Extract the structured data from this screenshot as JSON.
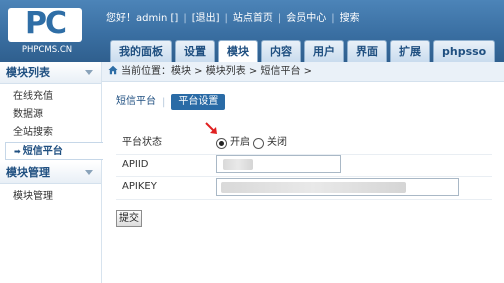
{
  "logo": {
    "text": "PC",
    "sub": "PHPCMS.CN"
  },
  "toplinks": {
    "greeting": "您好！admin []",
    "logout": "[退出]",
    "site_home": "站点首页",
    "member_center": "会员中心",
    "search": "搜索"
  },
  "nav": {
    "tabs": [
      "我的面板",
      "设置",
      "模块",
      "内容",
      "用户",
      "界面",
      "扩展",
      "phpsso"
    ],
    "active_index": 2
  },
  "sidebar": {
    "group1_title": "模块列表",
    "items": [
      "在线充值",
      "数据源",
      "全站搜索",
      "短信平台"
    ],
    "active_item": "短信平台",
    "group2_title": "模块管理",
    "group2_items": [
      "模块管理"
    ]
  },
  "breadcrumb": {
    "prefix": "当前位置：",
    "path": "模块 > 模块列表 > 短信平台 >"
  },
  "subtabs": {
    "first": "短信平台",
    "second": "平台设置"
  },
  "form": {
    "status_label": "平台状态",
    "status_on": "开启",
    "status_off": "关闭",
    "status_value": "开启",
    "apiid_label": "APIID",
    "apikey_label": "APIKEY",
    "submit_label": "提交"
  },
  "colors": {
    "header": "#3a6fa2",
    "accent": "#2a6ba6",
    "arrow": "#e02020"
  }
}
